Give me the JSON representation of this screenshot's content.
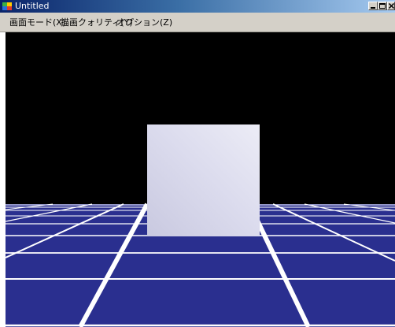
{
  "window": {
    "title": "Untitled",
    "icon": "app-logo-icon",
    "controls": [
      "minimize-icon",
      "maximize-icon",
      "close-icon"
    ]
  },
  "menubar": {
    "items": [
      {
        "label": "画面モード(X)"
      },
      {
        "label": "描画クォリティ(Y)"
      },
      {
        "label": "オプション(Z)"
      }
    ]
  },
  "scene": {
    "background_color": "#000000",
    "floor_color": "#2a2f8f",
    "grid_color": "#ffffff",
    "cube_color": "#d6d6ea"
  }
}
